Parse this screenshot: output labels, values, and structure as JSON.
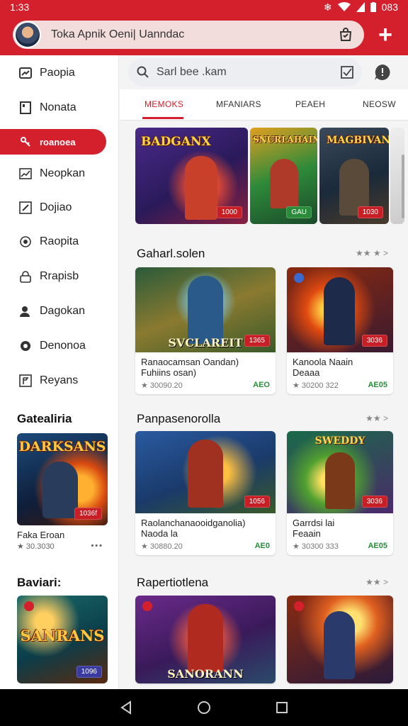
{
  "status": {
    "time": "1:33",
    "battery": "083"
  },
  "header": {
    "title": "Toka Apnik Oeni| Uanndac"
  },
  "search": {
    "placeholder": "Sarl bee .kam"
  },
  "sidebar": {
    "items": [
      {
        "label": "Paopia",
        "icon": "chart-icon"
      },
      {
        "label": "Nonata",
        "icon": "document-icon"
      },
      {
        "label": "roanoea",
        "icon": "key-icon",
        "active": true
      },
      {
        "label": "Neopkan",
        "icon": "trend-icon"
      },
      {
        "label": "Dojiao",
        "icon": "edit-icon"
      },
      {
        "label": "Raopita",
        "icon": "target-icon"
      },
      {
        "label": "Rrapisb",
        "icon": "lock-icon"
      },
      {
        "label": "Dagokan",
        "icon": "user-icon"
      },
      {
        "label": "Denonoa",
        "icon": "settings-icon"
      },
      {
        "label": "Reyans",
        "icon": "flag-icon"
      }
    ],
    "section1": {
      "title": "Gatealiria",
      "card": {
        "image_title": "DARKSANS",
        "badge": "1036f",
        "name": "Faka Eroan",
        "meta": "★ 30.3030"
      }
    },
    "section2": {
      "title": "Baviari:",
      "card": {
        "image_title": "SANRANS",
        "badge": "1096"
      }
    }
  },
  "tabs": [
    "MEMOKS",
    "MFANIARS",
    "PEAEH",
    "NEOSW"
  ],
  "banners": [
    {
      "title": "BADGANX",
      "badge": "1000"
    },
    {
      "title": "SNURLAHAIN",
      "badge": "GAU"
    },
    {
      "title": "MAGBIVAN",
      "badge": "1030"
    }
  ],
  "sections": [
    {
      "title": "Gaharl.solen",
      "more": "★★ ★ >",
      "cards": [
        {
          "image_title": "SVCLAREIT",
          "badge": "1365",
          "name": "Ranaocamsan Oandan)\nFuhiins osan)",
          "meta": "★ 30090.20",
          "price": "AEO"
        },
        {
          "image_title": "",
          "badge": "3036",
          "name": "Kanoola Naain\nDeaaa",
          "meta": "★ 30200 322",
          "price": "AE05"
        }
      ]
    },
    {
      "title": "Panpasenorolla",
      "more": "★★ >",
      "cards": [
        {
          "image_title": "",
          "badge": "1056",
          "name": "Raolanchanaooidganolia)\nNaoda la",
          "meta": "★ 30880.20",
          "price": "AE0"
        },
        {
          "image_title": "SWEDDY",
          "badge": "3036",
          "name": "Garrdsi lai\nFeaain",
          "meta": "★ 30300 333",
          "price": "AE05"
        }
      ]
    },
    {
      "title": "Rapertiotlena",
      "more": "★★ >",
      "cards": [
        {
          "image_title": "SANORANN"
        },
        {
          "image_title": ""
        }
      ]
    }
  ],
  "colors": {
    "accent": "#d4202c",
    "price": "#2a8c3a"
  }
}
